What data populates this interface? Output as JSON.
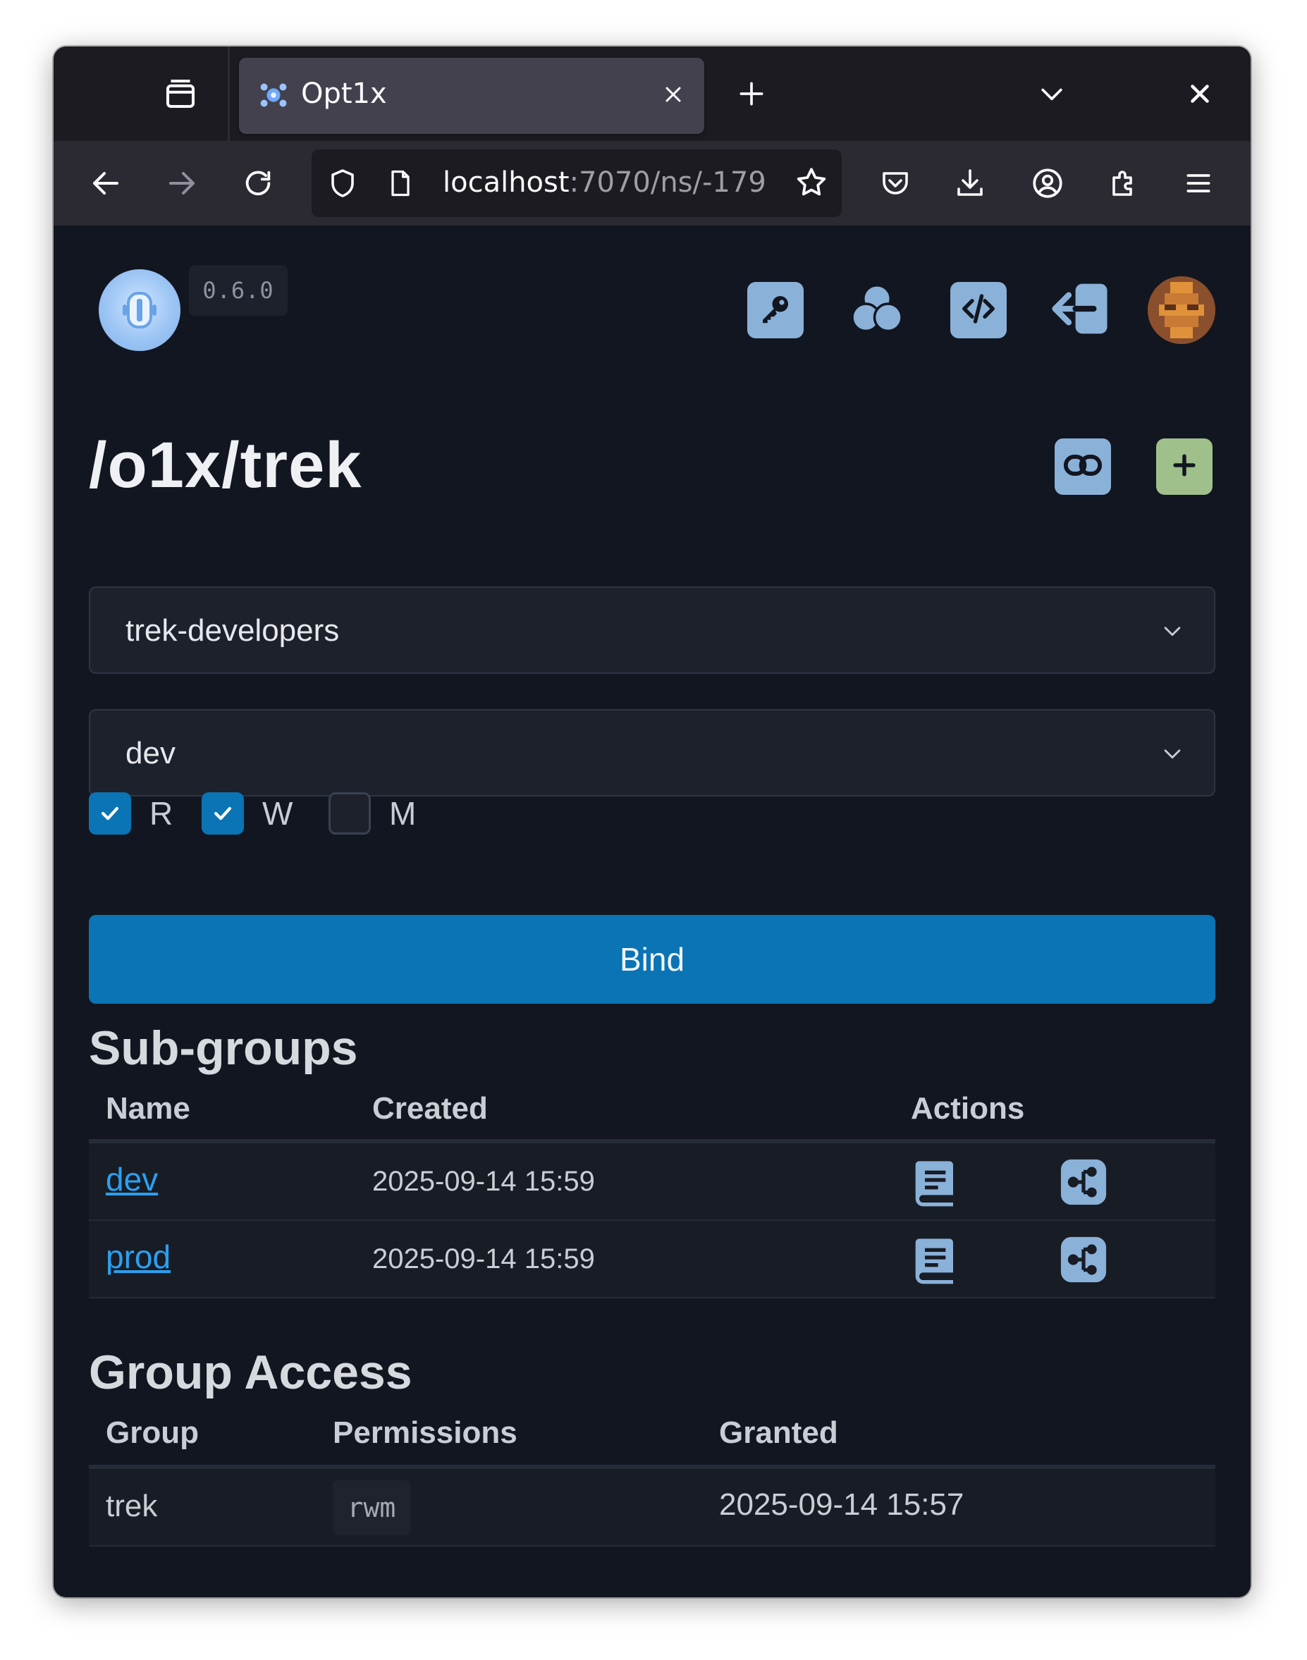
{
  "browser": {
    "tab": {
      "title": "Opt1x"
    },
    "url": {
      "host": "localhost",
      "rest": ":7070/ns/-179"
    }
  },
  "header": {
    "version": "0.6.0"
  },
  "page": {
    "title": "/o1x/trek",
    "group_select": {
      "value": "trek-developers"
    },
    "env_select": {
      "value": "dev"
    },
    "permissions": [
      {
        "label": "R",
        "checked": true
      },
      {
        "label": "W",
        "checked": true
      },
      {
        "label": "M",
        "checked": false
      }
    ],
    "bind_label": "Bind"
  },
  "subgroups": {
    "heading": "Sub-groups",
    "columns": [
      "Name",
      "Created",
      "Actions"
    ],
    "rows": [
      {
        "name": "dev",
        "created": "2025-09-14 15:59"
      },
      {
        "name": "prod",
        "created": "2025-09-14 15:59"
      }
    ]
  },
  "group_access": {
    "heading": "Group Access",
    "columns": [
      "Group",
      "Permissions",
      "Granted"
    ],
    "rows": [
      {
        "group": "trek",
        "permissions": "rwm",
        "granted": "2025-09-14 15:57"
      }
    ]
  },
  "colors": {
    "accent": "#0a74b4",
    "link": "#2aa0f0",
    "icon_button": "#8ab1d8",
    "add_button": "#9fc08a",
    "page_bg": "#121620"
  },
  "icons": {
    "toolbar": [
      "back-arrow-icon",
      "forward-arrow-icon",
      "reload-icon",
      "shield-icon",
      "page-icon",
      "star-icon",
      "pocket-icon",
      "download-icon",
      "account-icon",
      "extensions-icon",
      "menu-icon"
    ],
    "header": [
      "key-icon",
      "circles-icon",
      "code-icon",
      "logout-icon"
    ],
    "actions": [
      "link-icon",
      "plus-icon",
      "book-icon",
      "tree-icon"
    ]
  }
}
